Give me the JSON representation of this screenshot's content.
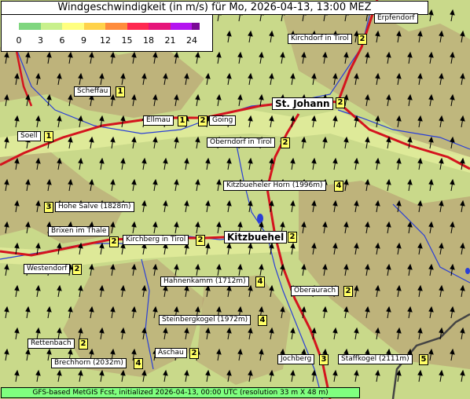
{
  "title": "Windgeschwindigkeit (in m/s) für Mo, 2026-04-13, 13:00 MEZ",
  "scale": {
    "ticks": [
      "0",
      "3",
      "6",
      "9",
      "12",
      "15",
      "18",
      "21",
      "24"
    ],
    "colors": [
      "#7fd67f",
      "#c8f08c",
      "#ffff80",
      "#ffd24a",
      "#ff8c3c",
      "#ff2850",
      "#e6147a",
      "#b414f0",
      "#7a0a96"
    ]
  },
  "places": [
    {
      "name": "Erpfendorf",
      "value": ""
    },
    {
      "name": "Kirchdorf in Tirol",
      "value": "2"
    },
    {
      "name": "Scheffau",
      "value": "1"
    },
    {
      "name": "St. Johann",
      "value": "2"
    },
    {
      "name": "Ellmau",
      "value": "1"
    },
    {
      "name": "Going",
      "value": "2"
    },
    {
      "name": "Soell",
      "value": "1"
    },
    {
      "name": "Oberndorf in Tirol",
      "value": "2"
    },
    {
      "name": "Kitzbueheler Horn (1996m)",
      "value": "4"
    },
    {
      "name": "Hohe Salve (1828m)",
      "value": "3"
    },
    {
      "name": "Brixen im Thale",
      "value": "2"
    },
    {
      "name": "Kirchberg in Tirol",
      "value": "2"
    },
    {
      "name": "Kitzbuehel",
      "value": "2"
    },
    {
      "name": "Westendorf",
      "value": "2"
    },
    {
      "name": "Hahnenkamm (1712m)",
      "value": "4"
    },
    {
      "name": "Oberaurach",
      "value": "2"
    },
    {
      "name": "Steinbergkogel (1972m)",
      "value": "4"
    },
    {
      "name": "Rettenbach",
      "value": "2"
    },
    {
      "name": "Aschau",
      "value": "2"
    },
    {
      "name": "Brechhorn (2032m)",
      "value": "4"
    },
    {
      "name": "Jochberg",
      "value": "3"
    },
    {
      "name": "Staffkogel (2111m)",
      "value": "5"
    }
  ],
  "footer": "GFS-based MetGIS Fcst, initialized 2026-04-13, 00:00 UTC  (resolution 33 m X 48 m)"
}
